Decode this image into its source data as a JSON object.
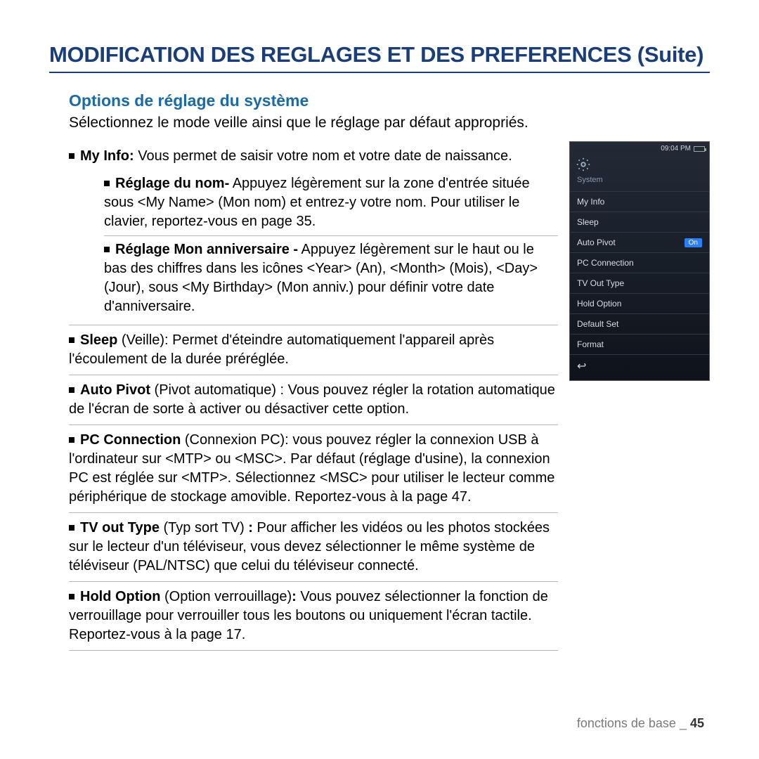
{
  "title": "MODIFICATION DES REGLAGES ET DES PREFERENCES (Suite)",
  "section_title": "Options de réglage du système",
  "intro": "Sélectionnez le mode veille ainsi que le réglage par défaut appropriés.",
  "items": {
    "myinfo": {
      "bold": "My Info:",
      "text": " Vous permet de saisir votre nom et votre date de naissance.",
      "sub1_bold": "Réglage du nom-",
      "sub1_text": " Appuyez légèrement sur la zone d'entrée située sous <My Name> (Mon nom) et entrez-y votre nom. Pour utiliser le clavier, reportez-vous en page 35.",
      "sub2_bold": "Réglage Mon anniversaire -",
      "sub2_text": " Appuyez légèrement sur le haut ou le bas des chiffres dans les icônes <Year> (An), <Month> (Mois), <Day> (Jour), sous <My Birthday> (Mon anniv.) pour définir votre date d'anniversaire."
    },
    "sleep": {
      "bold": "Sleep",
      "paren": " (Veille): ",
      "text": "Permet d'éteindre automatiquement l'appareil après l'écoulement de la durée préréglée."
    },
    "autopivot": {
      "bold": "Auto Pivot",
      "paren": " (Pivot automatique) : ",
      "text": "Vous pouvez régler la rotation automatique de l'écran de sorte à activer ou désactiver cette option."
    },
    "pcconn": {
      "bold": "PC Connection",
      "paren": " (Connexion PC): ",
      "text": "vous pouvez régler la connexion USB à l'ordinateur sur <MTP> ou <MSC>. Par défaut (réglage d'usine), la connexion PC est réglée sur <MTP>. Sélectionnez <MSC> pour utiliser le lecteur comme périphérique de stockage amovible. Reportez-vous à la page 47."
    },
    "tvout": {
      "bold": "TV out Type",
      "paren": " (Typ sort TV) ",
      "bold2": ":",
      "text": " Pour afficher les vidéos ou les photos stockées sur le lecteur d'un téléviseur, vous devez sélectionner le même système de téléviseur (PAL/NTSC) que celui du téléviseur connecté."
    },
    "hold": {
      "bold": "Hold Option",
      "paren": " (Option verrouillage)",
      "bold2": ":",
      "text": " Vous pouvez sélectionner la fonction de verrouillage pour verrouiller tous les boutons ou uniquement l'écran tactile. Reportez-vous à la page 17."
    }
  },
  "device": {
    "time": "09:04 PM",
    "header_label": "System",
    "rows": [
      {
        "label": "My Info",
        "badge": ""
      },
      {
        "label": "Sleep",
        "badge": ""
      },
      {
        "label": "Auto Pivot",
        "badge": "On"
      },
      {
        "label": "PC Connection",
        "badge": ""
      },
      {
        "label": "TV Out Type",
        "badge": ""
      },
      {
        "label": "Hold Option",
        "badge": ""
      },
      {
        "label": "Default Set",
        "badge": ""
      },
      {
        "label": "Format",
        "badge": ""
      }
    ],
    "back_icon": "↩"
  },
  "footer": {
    "text": "fonctions de base _ ",
    "page": "45"
  }
}
